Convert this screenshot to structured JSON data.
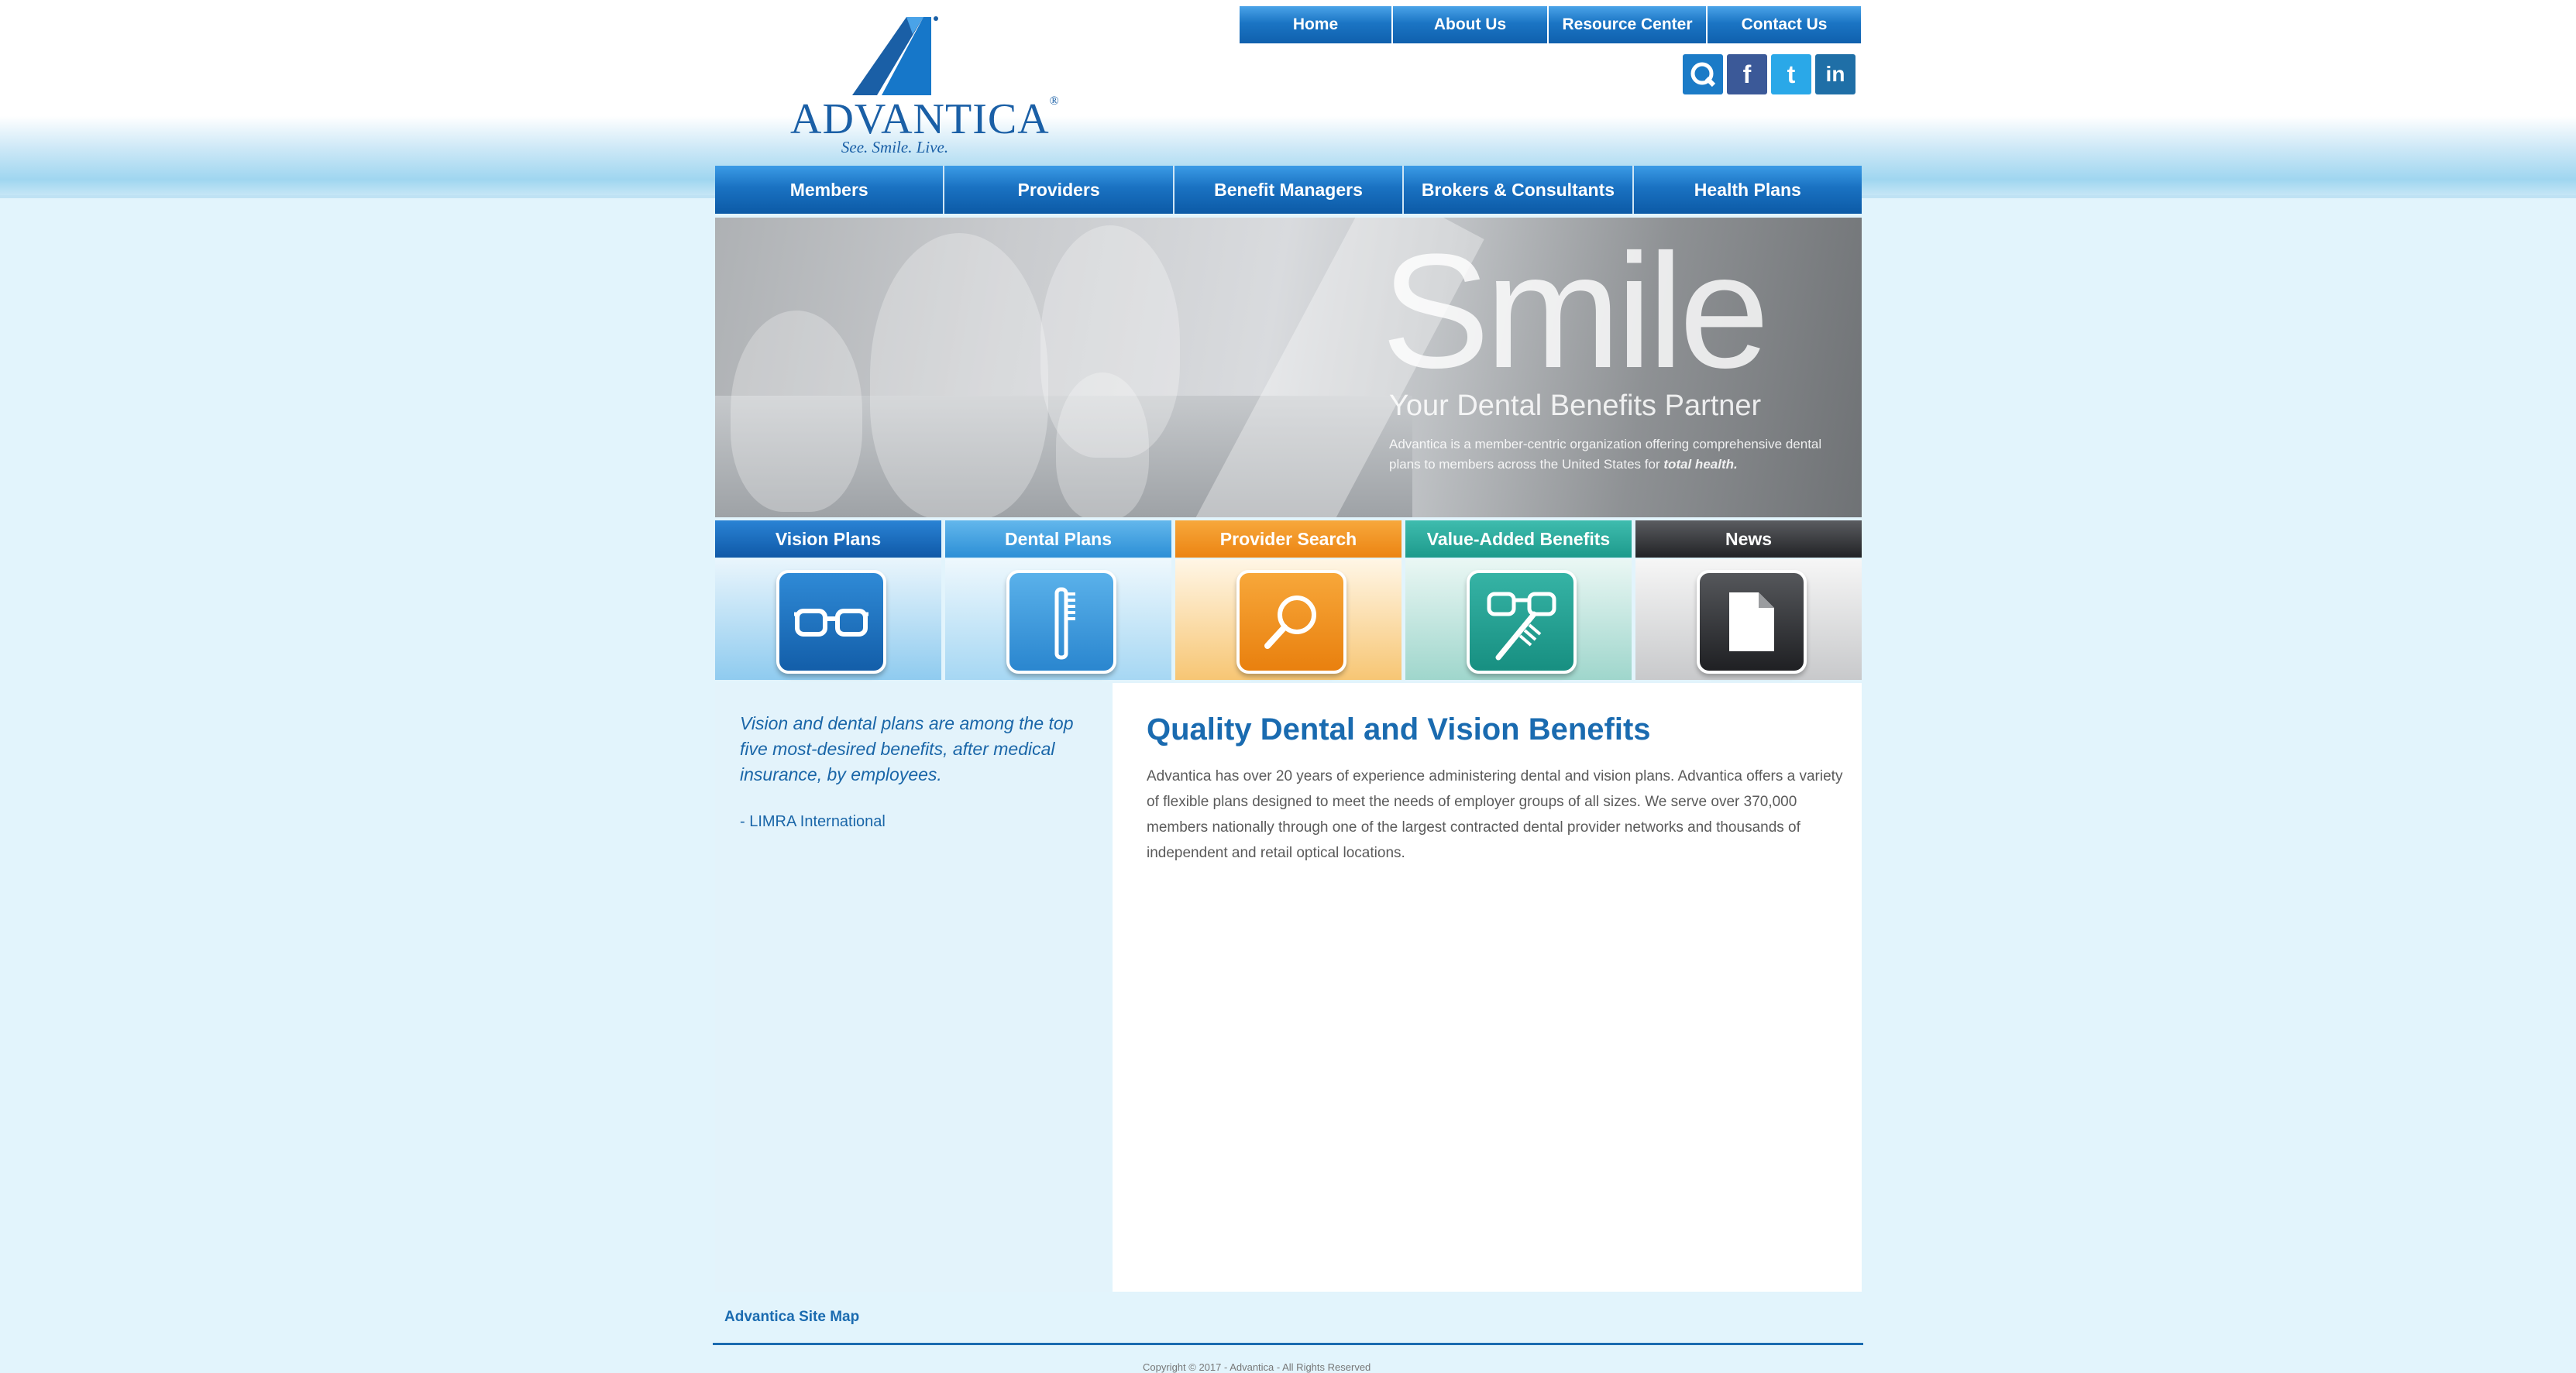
{
  "brand": {
    "name": "ADVANTICA",
    "tagline": "See. Smile. Live.",
    "logo_color": "#1a5fa6"
  },
  "top_nav": {
    "items": [
      {
        "label": "Home"
      },
      {
        "label": "About Us"
      },
      {
        "label": "Resource Center"
      },
      {
        "label": "Contact Us"
      }
    ]
  },
  "social": {
    "items": [
      {
        "icon": "advantica-q-icon",
        "glyph": "Q",
        "color": "#1b7bc7"
      },
      {
        "icon": "facebook-icon",
        "glyph": "f",
        "color": "#3b5998"
      },
      {
        "icon": "twitter-icon",
        "glyph": "t",
        "color": "#2aa8e8"
      },
      {
        "icon": "linkedin-icon",
        "glyph": "in",
        "color": "#1f6fa7"
      }
    ]
  },
  "main_nav": {
    "items": [
      {
        "label": "Members"
      },
      {
        "label": "Providers"
      },
      {
        "label": "Benefit Managers"
      },
      {
        "label": "Brokers & Consultants"
      },
      {
        "label": "Health Plans"
      }
    ]
  },
  "hero": {
    "headline": "Smile",
    "subtitle": "Your Dental Benefits Partner",
    "description_before": "Advantica is a member-centric organization offering comprehensive dental plans to members across the United States for ",
    "description_emphasis": "total health."
  },
  "tiles": [
    {
      "label": "Vision Plans",
      "icon": "eyeglasses-icon",
      "header_color": "#1565b5",
      "body_top": "#e9f5fc",
      "body_bottom": "#8fcbef",
      "icon_color": "#1a6bb8"
    },
    {
      "label": "Dental Plans",
      "icon": "toothbrush-icon",
      "header_color": "#3d9fe0",
      "body_top": "#eef8fd",
      "body_bottom": "#a6d7f3",
      "icon_color": "#3794d8"
    },
    {
      "label": "Provider Search",
      "icon": "magnifier-icon",
      "header_color": "#f0901e",
      "body_top": "#fff6e6",
      "body_bottom": "#f7c674",
      "icon_color": "#f0901e"
    },
    {
      "label": "Value-Added Benefits",
      "icon": "glasses-and-toothbrush-icon",
      "header_color": "#27a79a",
      "body_top": "#eaf7f4",
      "body_bottom": "#9fd6cc",
      "icon_color": "#1f9d8f"
    },
    {
      "label": "News",
      "icon": "document-icon",
      "header_color": "#3a3c40",
      "body_top": "#f6f6f6",
      "body_bottom": "#c8c9cb",
      "icon_color": "#3a3c40"
    }
  ],
  "sidebar": {
    "quote": "Vision and dental plans are among the top five most-desired benefits, after medical insurance, by employees.",
    "attribution": "- LIMRA International"
  },
  "content": {
    "heading": "Quality Dental and Vision Benefits",
    "body": "Advantica has over 20 years of experience administering dental and vision plans. Advantica offers a variety of flexible plans designed to meet the needs of employer groups of all sizes. We serve over 370,000 members nationally through one of the largest contracted dental provider networks and thousands of independent and retail optical locations."
  },
  "footer": {
    "sitemap_link": "Advantica Site Map",
    "copyright": "Copyright © 2017 - Advantica - All Rights Reserved"
  }
}
